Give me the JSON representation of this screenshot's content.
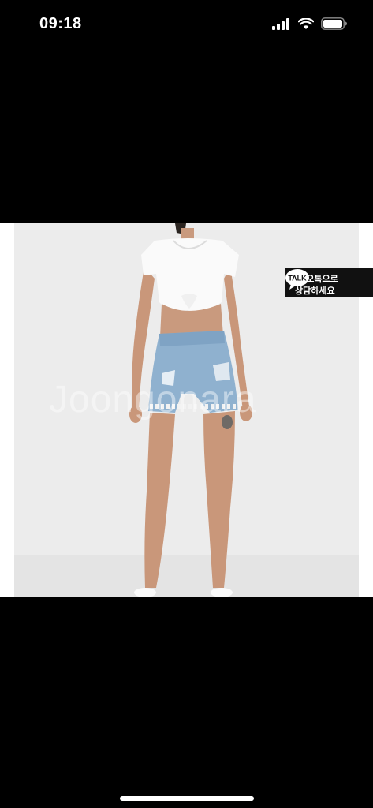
{
  "status_bar": {
    "time": "09:18",
    "icons": [
      "cellular-signal-icon",
      "wifi-icon",
      "battery-icon"
    ]
  },
  "photo": {
    "watermark": "Joongonara",
    "kakao_badge": {
      "line1": "카카오톡으로",
      "line2": "상담하세요",
      "bubble": "TALK"
    }
  },
  "colors": {
    "background": "#000000",
    "photo_wall": "#efefef",
    "kakao_badge": "#111111",
    "denim": "#8fb1cf"
  }
}
